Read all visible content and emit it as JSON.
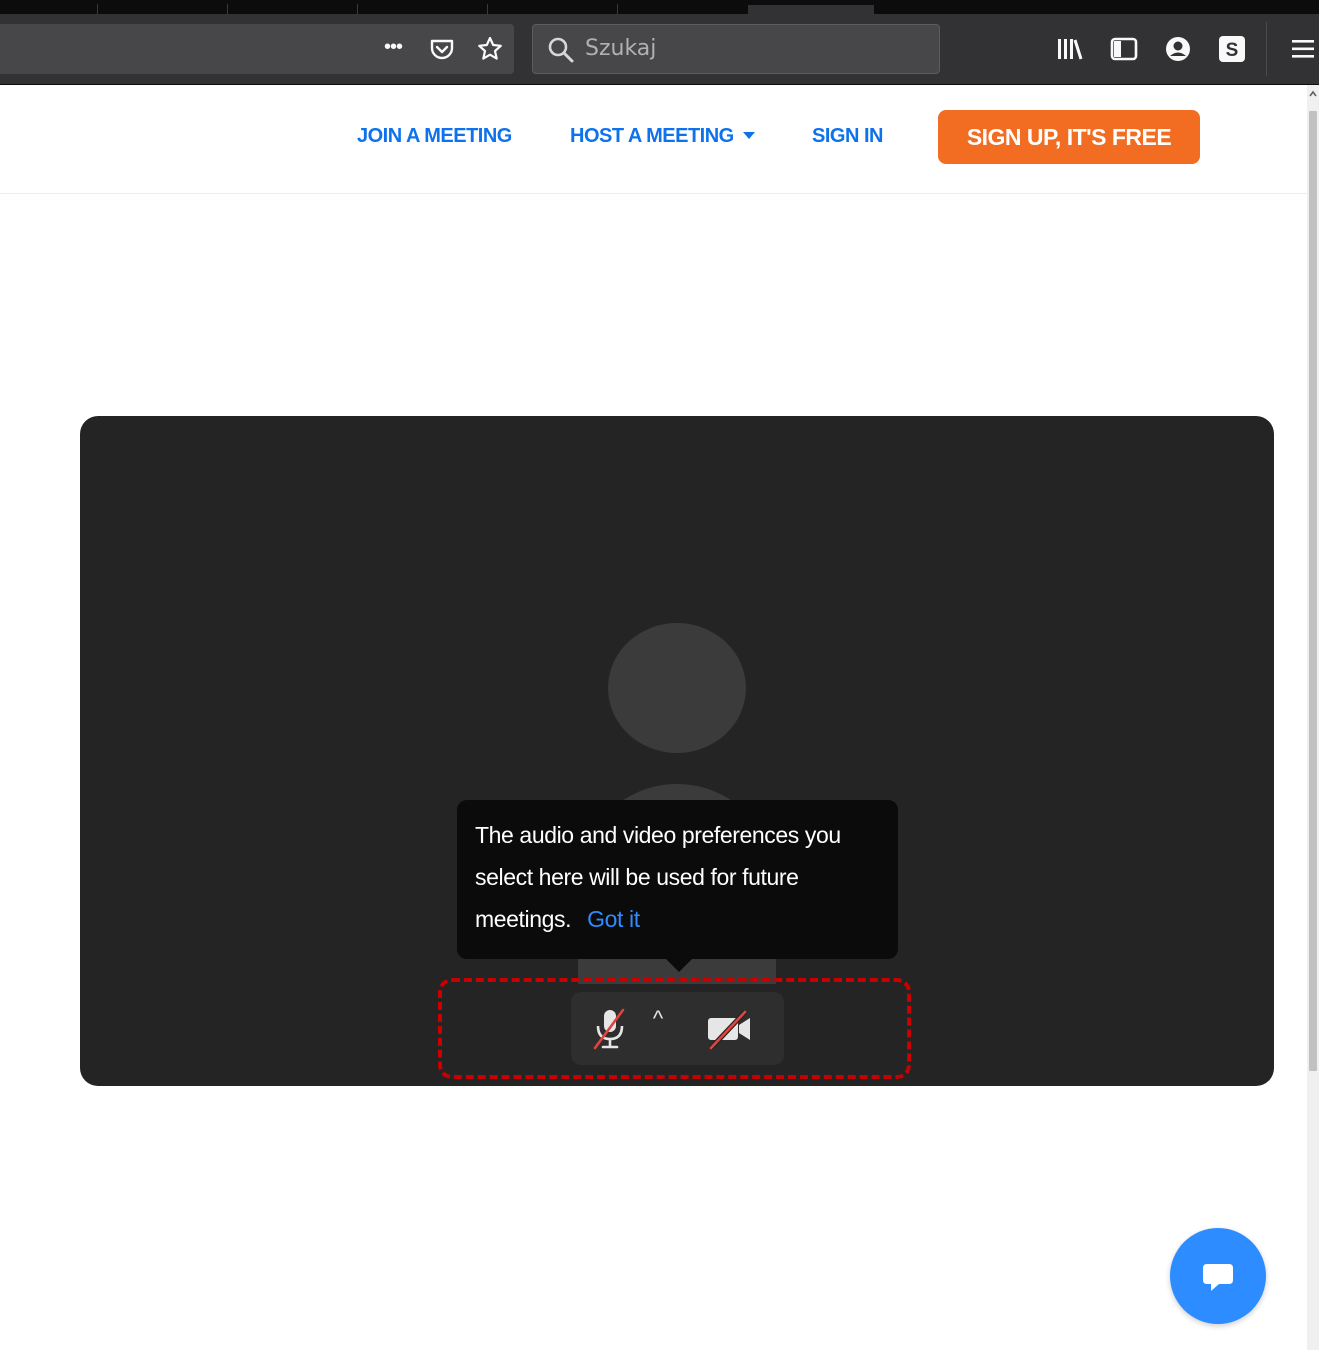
{
  "browser": {
    "search_placeholder": "Szukaj",
    "toolbar_icons": [
      "page-actions-icon",
      "pocket-icon",
      "bookmark-star-icon",
      "library-icon",
      "sidebar-icon",
      "account-icon",
      "extension-s-icon",
      "hamburger-menu-icon"
    ],
    "extension_letter": "S"
  },
  "nav": {
    "join": "JOIN A MEETING",
    "host": "HOST A MEETING",
    "signin": "SIGN IN",
    "signup": "SIGN UP, IT'S FREE"
  },
  "preview": {
    "tooltip_text": "The audio and video preferences you select here will be used for future meetings.",
    "tooltip_link": "Got it",
    "mic_state": "muted",
    "camera_state": "off",
    "options_arrow": "^"
  },
  "colors": {
    "accent_blue": "#0e72ed",
    "signup_orange": "#f26d21",
    "link_blue": "#2d8cff",
    "annotation_red": "#c80000"
  }
}
